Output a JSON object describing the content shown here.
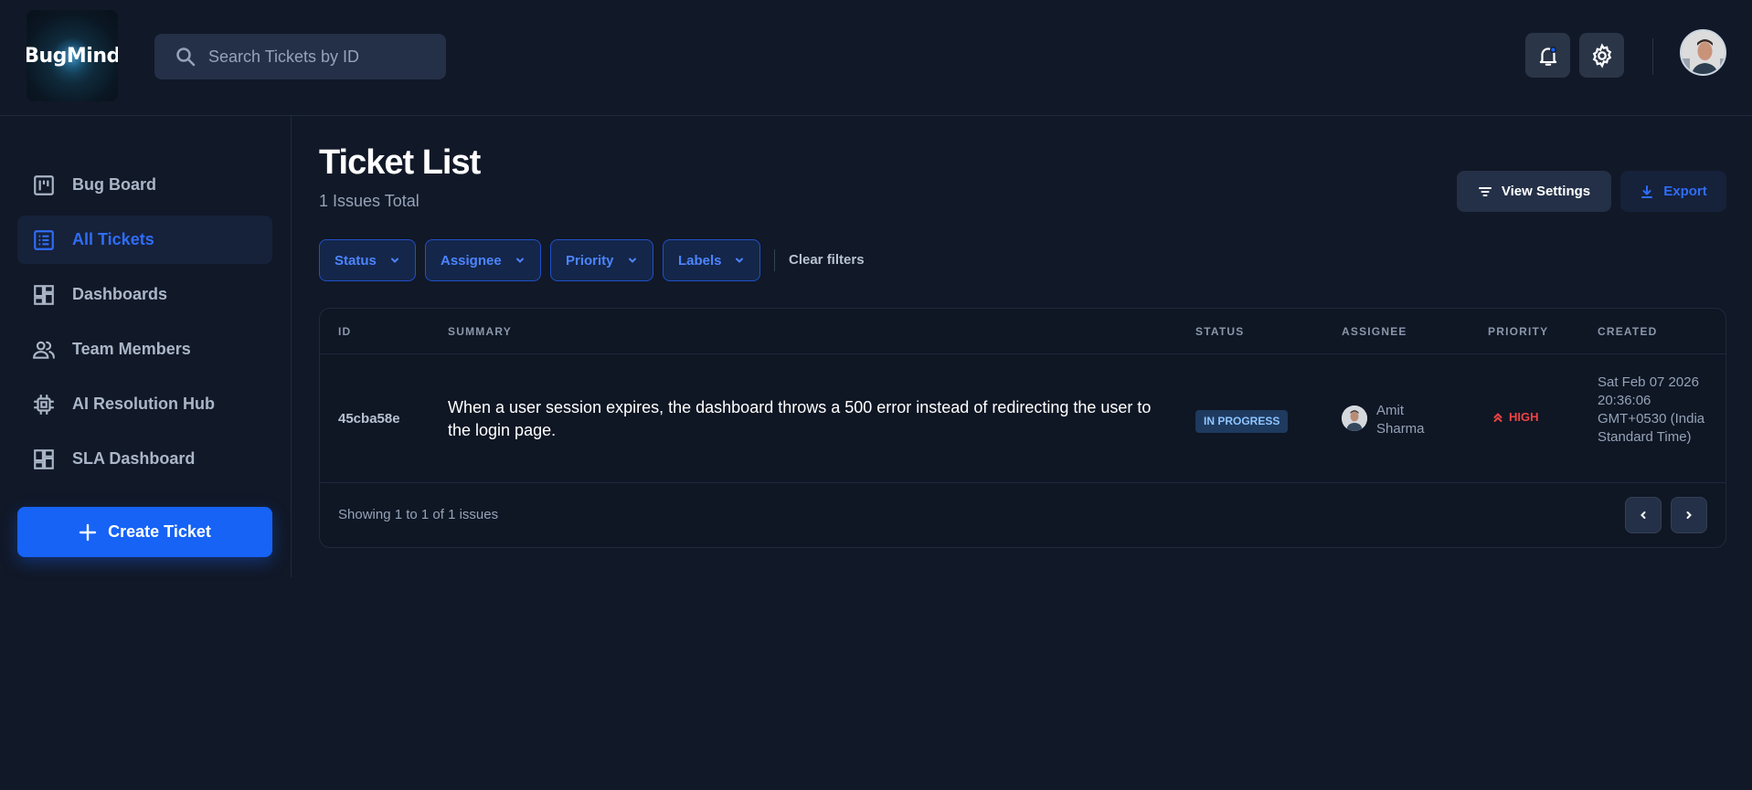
{
  "brand": {
    "logo_text": "BugMind"
  },
  "search": {
    "placeholder": "Search Tickets by ID"
  },
  "sidebar": {
    "items": [
      {
        "label": "Bug Board",
        "icon": "board-icon"
      },
      {
        "label": "All Tickets",
        "icon": "list-icon",
        "active": true
      },
      {
        "label": "Dashboards",
        "icon": "dashboard-icon"
      },
      {
        "label": "Team Members",
        "icon": "team-icon"
      },
      {
        "label": "AI Resolution Hub",
        "icon": "chip-icon"
      },
      {
        "label": "SLA Dashboard",
        "icon": "dashboard-icon"
      }
    ],
    "create_label": "Create Ticket"
  },
  "main": {
    "title": "Ticket List",
    "subtitle": "1 Issues Total",
    "view_settings_label": "View Settings",
    "export_label": "Export",
    "filters": [
      "Status",
      "Assignee",
      "Priority",
      "Labels"
    ],
    "clear_filters_label": "Clear filters"
  },
  "table": {
    "headers": [
      "ID",
      "SUMMARY",
      "STATUS",
      "ASSIGNEE",
      "PRIORITY",
      "CREATED"
    ],
    "rows": [
      {
        "id": "45cba58e",
        "summary": "When a user session expires, the dashboard throws a 500 error instead of redirecting the user to the login page.",
        "status": "IN PROGRESS",
        "assignee": "Amit Sharma",
        "priority": "HIGH",
        "created": "Sat Feb 07 2026 20:36:06 GMT+0530 (India Standard Time)"
      }
    ],
    "footer": "Showing 1 to 1 of 1 issues"
  },
  "colors": {
    "background": "#111827",
    "accent": "#1663f5",
    "status_badge": "#1e3a5f",
    "priority_high": "#ef4444"
  }
}
